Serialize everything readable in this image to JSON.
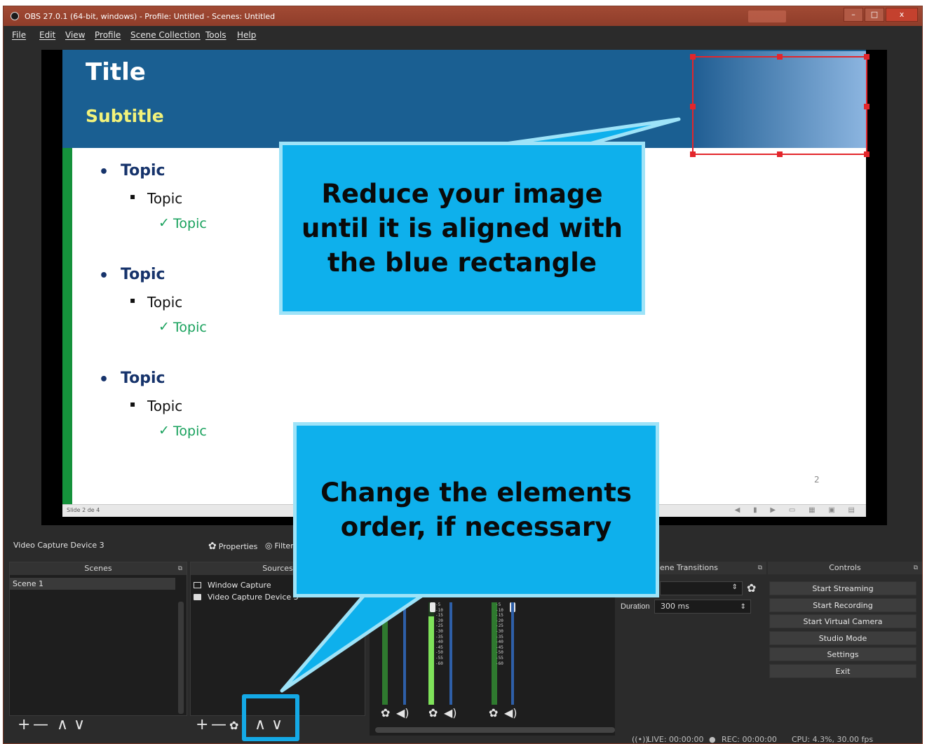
{
  "window": {
    "title": "OBS 27.0.1 (64-bit, windows) - Profile: Untitled - Scenes: Untitled",
    "btn_minimize": "–",
    "btn_maximize": "□",
    "btn_close": "x"
  },
  "menu": [
    "File",
    "Edit",
    "View",
    "Profile",
    "Scene Collection",
    "Tools",
    "Help"
  ],
  "slide": {
    "title": "Title",
    "subtitle": "Subtitle",
    "level1": "Topic",
    "level2": "Topic",
    "level3": "Topic",
    "bullet1": "•",
    "bullet2": "▪",
    "check": "✓",
    "page_number": "2",
    "status": "Slide 2 de 4",
    "controls": "◀ ▮ ▶ ▭ ▦ ▣ ▤"
  },
  "source_bar": {
    "selected_source": "Video Capture Device 3",
    "properties": "Properties",
    "filters": "Filters"
  },
  "scenes": {
    "header": "Scenes",
    "items": [
      "Scene 1"
    ],
    "toolbar": [
      "+",
      "—",
      "∧",
      "∨"
    ]
  },
  "sources": {
    "header": "Sources",
    "items": [
      "Window Capture",
      "Video Capture Device 3"
    ],
    "toolbar": [
      "+",
      "—",
      "✿",
      "∧",
      "∨"
    ]
  },
  "mixer": {
    "scale": [
      "-5",
      "-10",
      "-15",
      "-20",
      "-25",
      "-30",
      "-35",
      "-40",
      "-45",
      "-50",
      "-55",
      "-60"
    ],
    "gear": "✿",
    "speaker": "◀)"
  },
  "transitions": {
    "header": "Scene Transitions",
    "header_visible": "ene Transitions",
    "duration_label": "Duration",
    "duration_value": "300 ms"
  },
  "controls": {
    "header": "Controls",
    "buttons": [
      "Start Streaming",
      "Start Recording",
      "Start Virtual Camera",
      "Studio Mode",
      "Settings",
      "Exit"
    ]
  },
  "status": {
    "live": "LIVE: 00:00:00",
    "rec": "REC: 00:00:00",
    "cpu": "CPU: 4.3%, 30.00 fps",
    "live_icon": "((•))",
    "rec_icon": "●"
  },
  "callouts": {
    "top": [
      "Reduce your image",
      "until it is aligned with",
      "the blue rectangle"
    ],
    "bottom": [
      "Change the elements",
      "order, if necessary"
    ]
  },
  "colors": {
    "callout": "#0eb0ec",
    "slide_band": "#1a5f92",
    "selection": "#e3262b",
    "titlebar": "#a14a34"
  }
}
